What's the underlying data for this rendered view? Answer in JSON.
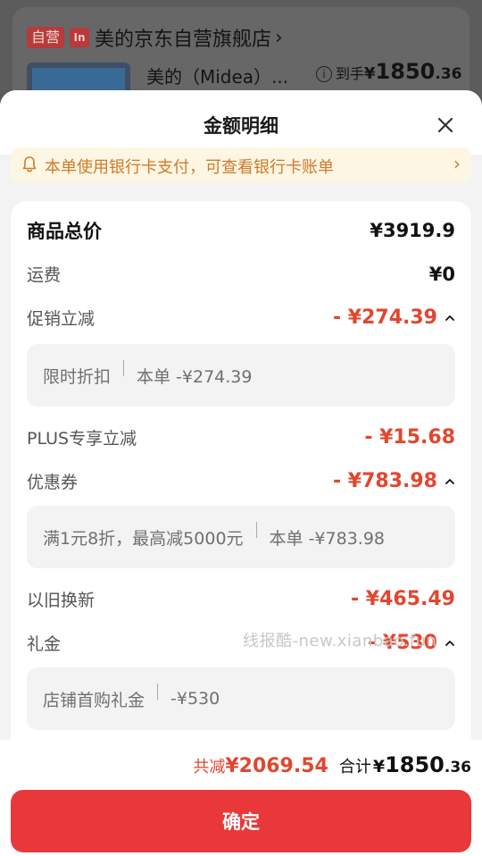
{
  "background": {
    "shop": {
      "tag_self": "自营",
      "brand_badge": "In",
      "name": "美的京东自营旗舰店",
      "arrow": "›"
    },
    "product": {
      "title": "美的（Midea）...",
      "info_icon": "i",
      "price_label": "到手",
      "price_yen": "¥",
      "price_int": "1850",
      "price_dec": ".36"
    }
  },
  "sheet": {
    "title": "金额明细",
    "close_icon": "close-icon"
  },
  "notice": {
    "text": "本单使用银行卡支付，可查看银行卡账单",
    "arrow": "›",
    "color": "#d07a2a"
  },
  "details": {
    "total": {
      "label": "商品总价",
      "value": "¥3919.9"
    },
    "shipping": {
      "label": "运费",
      "value": "¥0"
    },
    "promo": {
      "label": "促销立减",
      "value": "- ¥274.39",
      "sub": {
        "name": "限时折扣",
        "detail": "本单 -¥274.39"
      }
    },
    "plus": {
      "label": "PLUS专享立减",
      "value": "- ¥15.68"
    },
    "coupon": {
      "label": "优惠券",
      "value": "- ¥783.98",
      "sub": {
        "name": "满1元8折，最高减5000元",
        "detail": "本单 -¥783.98"
      }
    },
    "tradein": {
      "label": "以旧换新",
      "value": "- ¥465.49"
    },
    "gift": {
      "label": "礼金",
      "value": "- ¥530",
      "sub": {
        "name": "店铺首购礼金",
        "detail": "-¥530"
      }
    }
  },
  "watermark": "线报酷-new.xianbao.fun",
  "footer": {
    "savings_label": "共减",
    "savings_value": "¥2069.54",
    "total_label": "合计",
    "total_yen": "¥",
    "total_int": "1850",
    "total_dec": ".36",
    "confirm_label": "确定",
    "accent_color": "#e9383a",
    "discount_color": "#e2462f"
  }
}
